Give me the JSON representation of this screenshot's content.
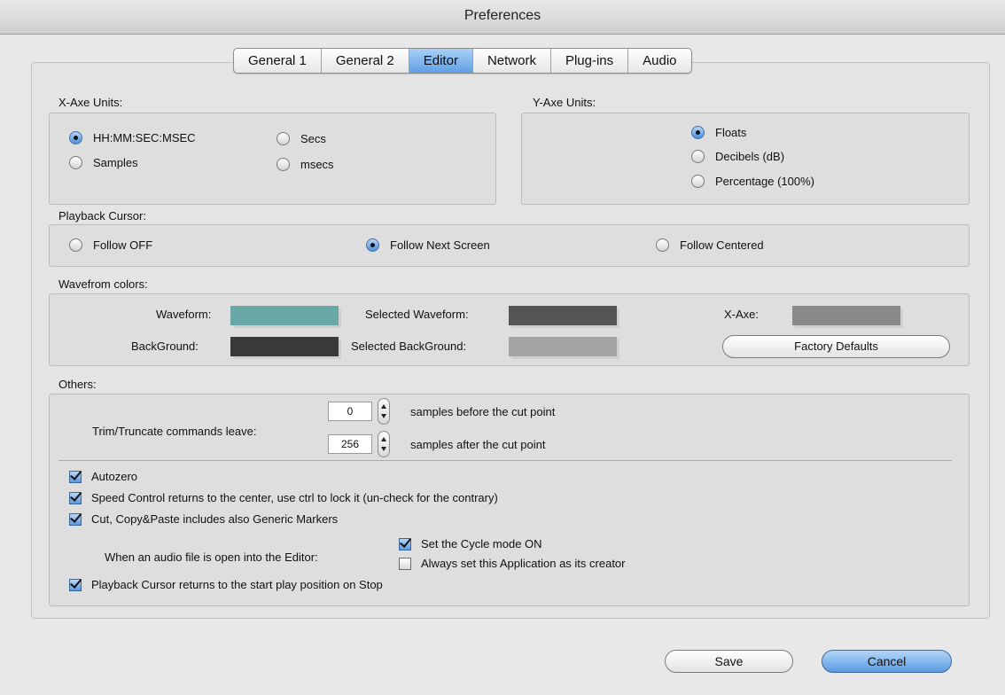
{
  "window": {
    "title": "Preferences"
  },
  "tabs": [
    {
      "label": "General 1",
      "active": false
    },
    {
      "label": "General 2",
      "active": false
    },
    {
      "label": "Editor",
      "active": true
    },
    {
      "label": "Network",
      "active": false
    },
    {
      "label": "Plug-ins",
      "active": false
    },
    {
      "label": "Audio",
      "active": false
    }
  ],
  "x_axe": {
    "title": "X-Axe Units:",
    "options": [
      "HH:MM:SEC:MSEC",
      "Samples",
      "Secs",
      "msecs"
    ],
    "selected": "HH:MM:SEC:MSEC"
  },
  "y_axe": {
    "title": "Y-Axe Units:",
    "options": [
      "Floats",
      "Decibels (dB)",
      "Percentage (100%)"
    ],
    "selected": "Floats"
  },
  "playback": {
    "title": "Playback Cursor:",
    "options": [
      "Follow OFF",
      "Follow Next Screen",
      "Follow Centered"
    ],
    "selected": "Follow Next Screen"
  },
  "colors": {
    "title": "Wavefrom colors:",
    "waveform_label": "Waveform:",
    "waveform_color": "#6aa7a7",
    "background_label": "BackGround:",
    "background_color": "#3a3a3a",
    "selected_waveform_label": "Selected Waveform:",
    "selected_waveform_color": "#555555",
    "selected_background_label": "Selected BackGround:",
    "selected_background_color": "#a4a4a4",
    "x_axe_label": "X-Axe:",
    "x_axe_color": "#8a8a8a",
    "factory_defaults": "Factory Defaults"
  },
  "others": {
    "title": "Others:",
    "trim_label": "Trim/Truncate commands leave:",
    "before_value": "0",
    "before_label": "samples before the cut point",
    "after_value": "256",
    "after_label": "samples after the cut point",
    "autozero": {
      "label": "Autozero",
      "checked": true
    },
    "speed_control": {
      "label": "Speed Control returns to the center, use ctrl to lock it (un-check for the contrary)",
      "checked": true
    },
    "cut_copy": {
      "label": "Cut, Copy&Paste includes also Generic Markers",
      "checked": true
    },
    "open_label": "When an audio file is open into the Editor:",
    "cycle_mode": {
      "label": "Set the Cycle mode ON",
      "checked": true
    },
    "always_creator": {
      "label": "Always set this Application as its creator",
      "checked": false
    },
    "playback_return": {
      "label": "Playback Cursor returns to the start play position on Stop",
      "checked": true
    }
  },
  "buttons": {
    "save": "Save",
    "cancel": "Cancel"
  }
}
